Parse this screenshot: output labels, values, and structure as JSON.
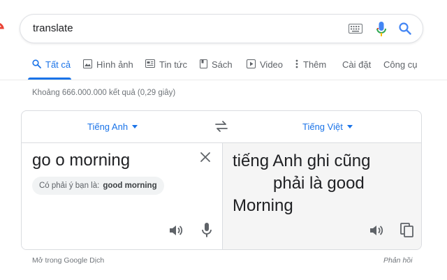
{
  "search": {
    "query": "translate"
  },
  "tabs": [
    {
      "label": "Tất cả",
      "icon": "search-icon",
      "active": true
    },
    {
      "label": "Hình ảnh",
      "icon": "image-icon",
      "active": false
    },
    {
      "label": "Tin tức",
      "icon": "news-icon",
      "active": false
    },
    {
      "label": "Sách",
      "icon": "book-icon",
      "active": false
    },
    {
      "label": "Video",
      "icon": "video-icon",
      "active": false
    },
    {
      "label": "Thêm",
      "icon": "more-vert-icon",
      "active": false
    },
    {
      "label": "Cài đặt",
      "active": false
    },
    {
      "label": "Công cụ",
      "active": false
    }
  ],
  "result_stats": "Khoảng 666.000.000 kết quả (0,29 giây)",
  "translator": {
    "source_lang": "Tiếng Anh",
    "target_lang": "Tiếng Việt",
    "source_text": "go o morning",
    "did_you_mean_prefix": "Có phải ý bạn là:",
    "did_you_mean_suggestion": "good morning",
    "target_line1": "tiếng Anh ghi cũng",
    "target_line2": "phải là good",
    "target_line3": "Morning"
  },
  "footer": {
    "open_in": "Mở trong Google Dịch",
    "feedback": "Phản hồi"
  },
  "colors": {
    "accent": "#1a73e8",
    "mic_blue": "#4285f4",
    "mic_red": "#ea4335",
    "muted": "#5f6368"
  }
}
